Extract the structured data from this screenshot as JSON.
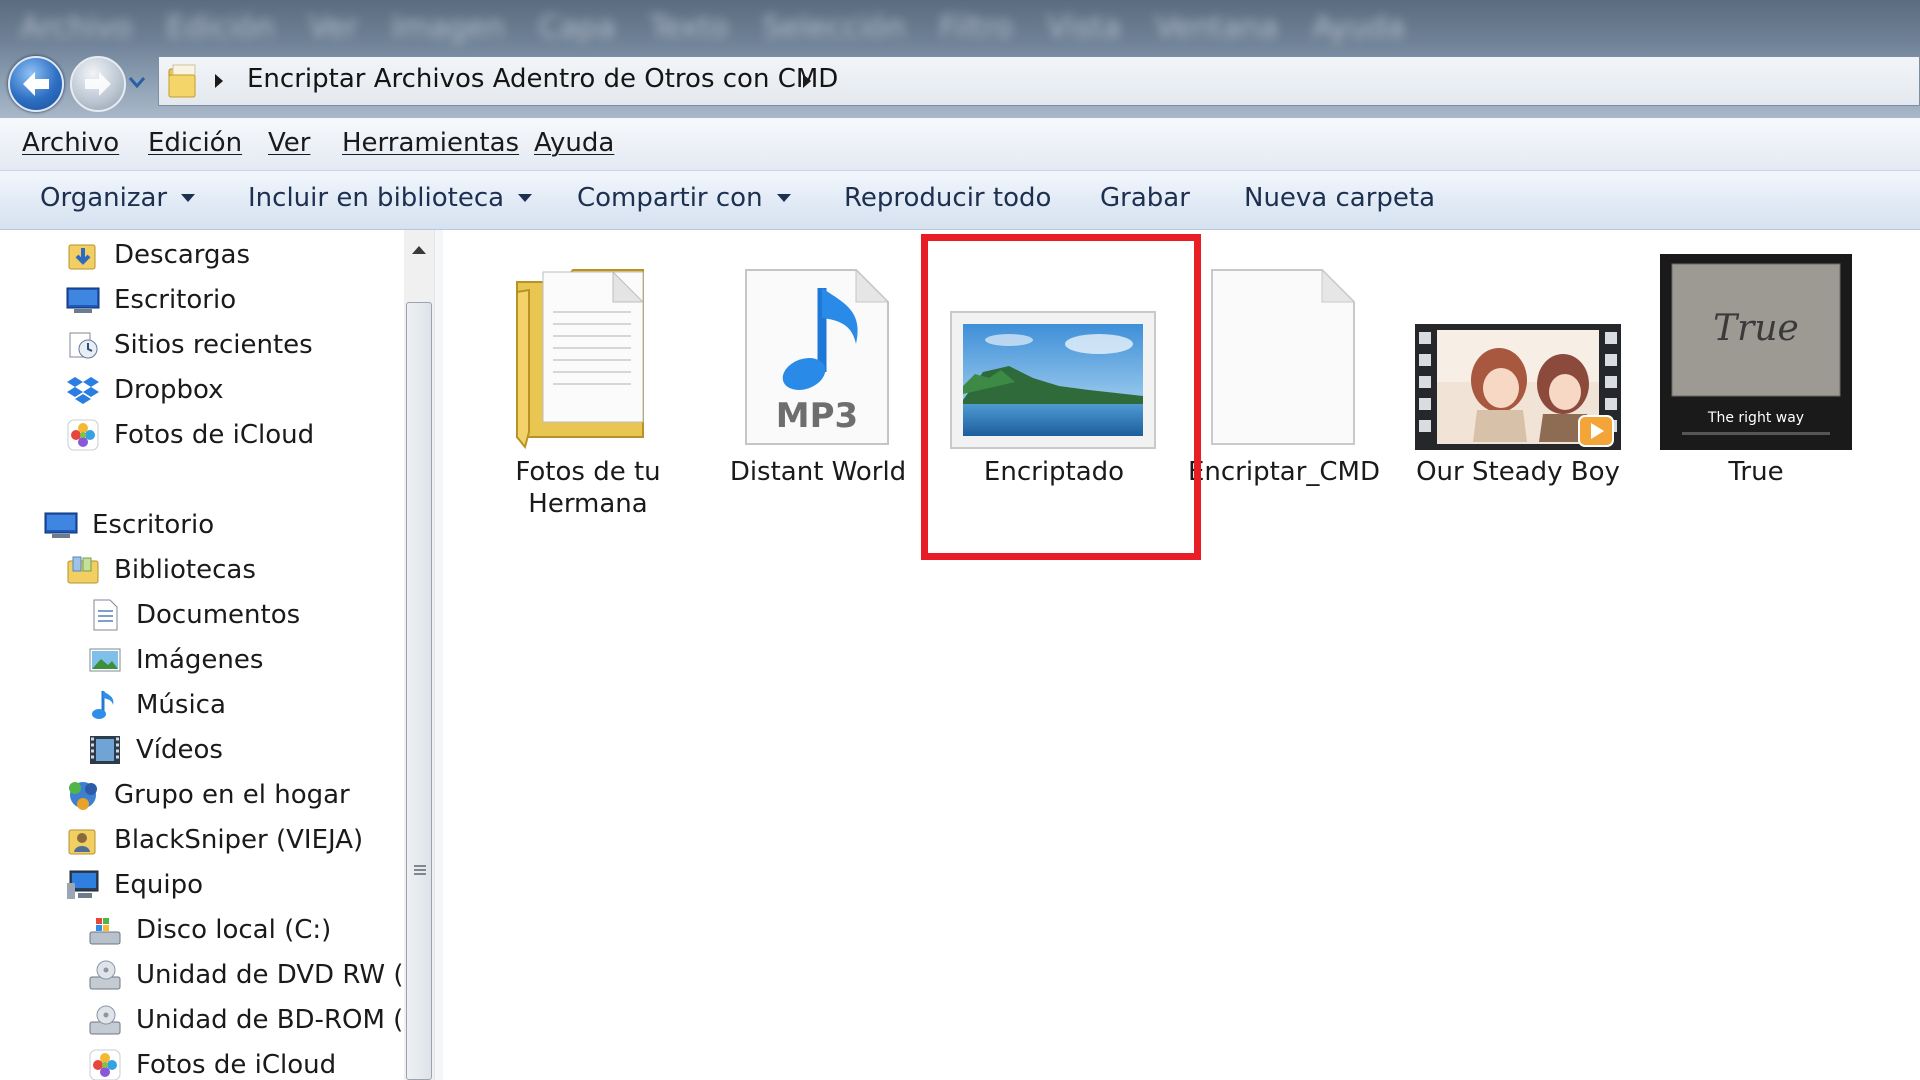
{
  "window": {
    "blurred_menu": [
      "Archivo",
      "Edición",
      "Ver",
      "Imagen",
      "Capa",
      "Texto",
      "Selección",
      "Filtro",
      "Vista",
      "Ventana",
      "Ayuda"
    ],
    "address_path": "Encriptar Archivos Adentro de Otros con CMD"
  },
  "menubar": {
    "items": [
      {
        "label": "Archivo"
      },
      {
        "label": "Edición"
      },
      {
        "label": "Ver"
      },
      {
        "label": "Herramientas"
      },
      {
        "label": "Ayuda"
      }
    ]
  },
  "toolbar": {
    "organize": "Organizar",
    "include_library": "Incluir en biblioteca",
    "share_with": "Compartir con",
    "play_all": "Reproducir todo",
    "burn": "Grabar",
    "new_folder": "Nueva carpeta"
  },
  "nav": {
    "favorites": [
      {
        "label": "Descargas",
        "icon": "downloads-folder-icon"
      },
      {
        "label": "Escritorio",
        "icon": "desktop-icon"
      },
      {
        "label": "Sitios recientes",
        "icon": "recent-places-icon"
      },
      {
        "label": "Dropbox",
        "icon": "dropbox-icon"
      },
      {
        "label": "Fotos de iCloud",
        "icon": "icloud-photos-icon"
      }
    ],
    "tree": [
      {
        "label": "Escritorio",
        "icon": "desktop-icon"
      },
      {
        "label": "Bibliotecas",
        "icon": "libraries-icon"
      },
      {
        "label": "Documentos",
        "icon": "documents-icon"
      },
      {
        "label": "Imágenes",
        "icon": "pictures-icon"
      },
      {
        "label": "Música",
        "icon": "music-icon"
      },
      {
        "label": "Vídeos",
        "icon": "videos-icon"
      },
      {
        "label": "Grupo en el hogar",
        "icon": "homegroup-icon"
      },
      {
        "label": "BlackSniper (VIEJA)",
        "icon": "user-folder-icon"
      },
      {
        "label": "Equipo",
        "icon": "computer-icon"
      },
      {
        "label": "Disco local (C:)",
        "icon": "local-disk-icon"
      },
      {
        "label": "Unidad de DVD RW (D:)",
        "icon": "dvd-drive-icon"
      },
      {
        "label": "Unidad de BD-ROM (E:)",
        "icon": "bd-drive-icon"
      },
      {
        "label": "Fotos de iCloud",
        "icon": "icloud-photos-icon"
      }
    ]
  },
  "files": [
    {
      "label": "Fotos de tu Hermana",
      "icon": "folder-icon"
    },
    {
      "label": "Distant World",
      "icon": "mp3-file-icon",
      "badge": "MP3"
    },
    {
      "label": "Encriptado",
      "icon": "image-file-icon"
    },
    {
      "label": "Encriptar_CMD",
      "icon": "blank-file-icon"
    },
    {
      "label": "Our Steady Boy",
      "icon": "video-file-icon"
    },
    {
      "label": "True",
      "icon": "video-thumbnail-icon",
      "thumb_text": "True",
      "thumb_caption": "The right way"
    }
  ],
  "colors": {
    "selection_outline": "#e81d25",
    "toolbar_text": "#1e3050",
    "accent_blue": "#2d6fc3"
  }
}
